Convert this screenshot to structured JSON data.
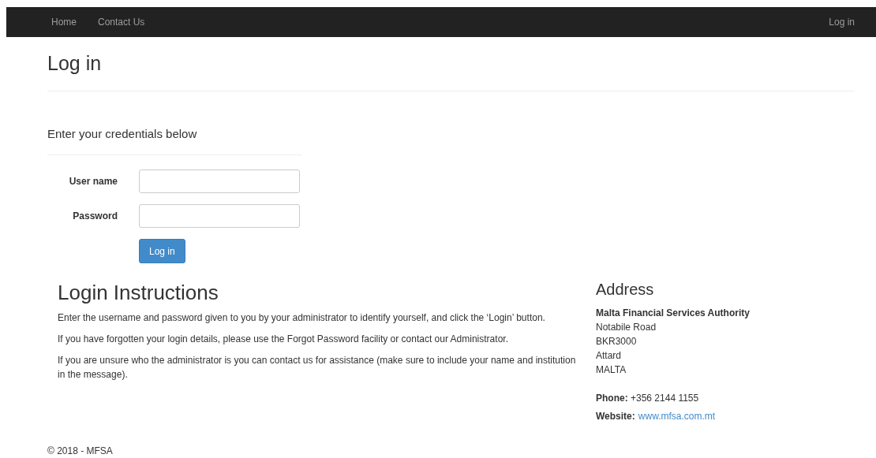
{
  "navbar": {
    "links": [
      "Home",
      "Contact Us"
    ],
    "right_link": "Log in"
  },
  "page_title": "Log in",
  "form": {
    "subtitle": "Enter your credentials below",
    "fields": [
      {
        "label": "User name"
      },
      {
        "label": "Password"
      }
    ],
    "submit": "Log in"
  },
  "instructions": {
    "heading": "Login Instructions",
    "paragraphs": [
      "Enter the username and password given to you by your administrator to identify yourself, and click the ‘Login’ button.",
      "If you have forgotten your login details, please use the Forgot Password facility or contact our Administrator.",
      "If you are unsure who the administrator is you can contact us for assistance (make sure to include your name and institution in the message)."
    ]
  },
  "address": {
    "heading": "Address",
    "organisation": "Malta Financial Services Authority",
    "lines": [
      "Notabile Road",
      "BKR3000",
      "Attard",
      "MALTA"
    ],
    "phone": "**Phone:** +356 2144 1155",
    "website_label": "Website:",
    "website": "www.mfsa.com.mt"
  },
  "footer": "© 2018 - MFSA"
}
